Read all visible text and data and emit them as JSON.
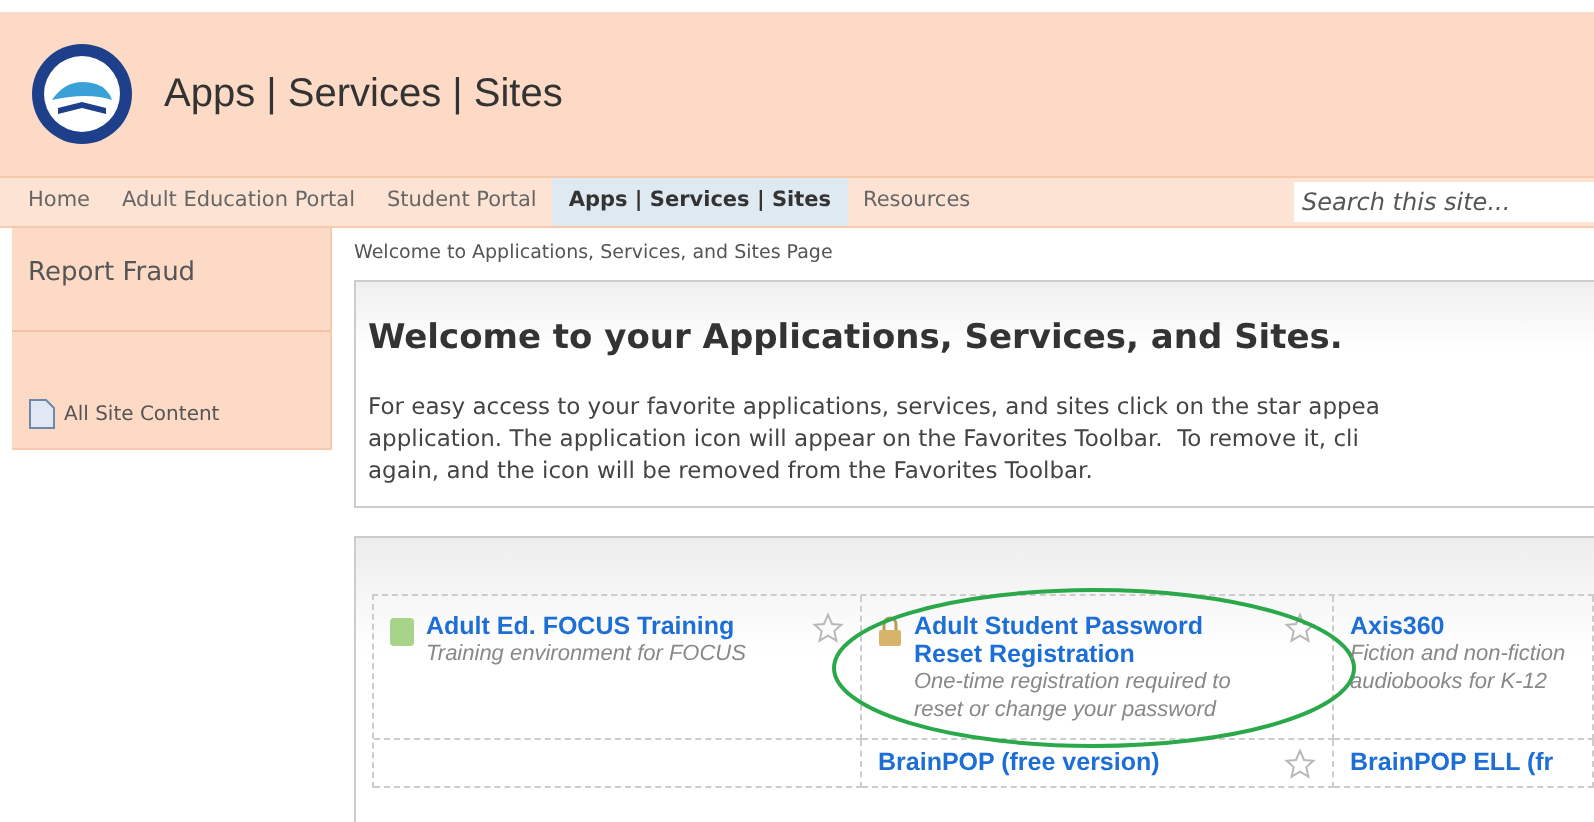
{
  "header": {
    "title": "Apps | Services | Sites"
  },
  "nav": {
    "tabs": [
      {
        "label": "Home",
        "selected": false
      },
      {
        "label": "Adult Education Portal",
        "selected": false
      },
      {
        "label": "Student Portal",
        "selected": false
      },
      {
        "label": "Apps | Services | Sites",
        "selected": true
      },
      {
        "label": "Resources",
        "selected": false
      }
    ],
    "search": {
      "placeholder": "Search this site..."
    }
  },
  "sidebar": {
    "items": [
      {
        "label": "Report Fraud",
        "kind": "link"
      },
      {
        "label": "All Site Content",
        "kind": "content"
      }
    ]
  },
  "breadcrumb": "Welcome to Applications, Services, and Sites Page",
  "intro": {
    "heading": "Welcome to your Applications, Services, and Sites.",
    "lines": [
      "For easy access to your favorite applications, services, and sites click on the star appea",
      "application. The application icon will appear on the Favorites Toolbar.  To remove it, cli",
      "again, and the icon will be removed from the Favorites Toolbar."
    ]
  },
  "tiles": [
    {
      "title": "Adult Ed. FOCUS Training",
      "description": "Training environment for FOCUS",
      "kind": "book",
      "highlighted": false
    },
    {
      "title": "Adult Student Password Reset Registration",
      "description": "One-time registration required to reset or change your password",
      "kind": "lock",
      "highlighted": true
    },
    {
      "title": "Axis360",
      "description": "Fiction and non-fiction audiobooks for K-12",
      "kind": "none",
      "highlighted": false
    },
    {
      "kind": "empty",
      "highlighted": false
    },
    {
      "title": "BrainPOP (free version)",
      "kind": "none",
      "highlighted": false
    },
    {
      "title": "BrainPOP ELL (fr",
      "kind": "none",
      "highlighted": false
    }
  ]
}
